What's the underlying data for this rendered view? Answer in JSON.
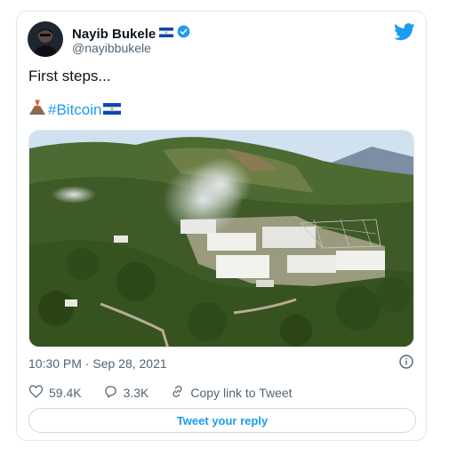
{
  "tweet": {
    "author_name": "Nayib Bukele",
    "author_handle": "@nayibbukele",
    "text": "First steps...",
    "hashtag": "#Bitcoin",
    "timestamp": "10:30 PM · Sep 28, 2021",
    "likes": "59.4K",
    "replies": "3.3K",
    "copy_link_label": "Copy link to Tweet",
    "reply_button_label": "Tweet your reply"
  },
  "icons": [
    "el-salvador-flag-icon",
    "verified-badge-icon",
    "twitter-logo-icon",
    "volcano-emoji-icon",
    "info-icon",
    "heart-icon",
    "reply-icon",
    "link-icon"
  ],
  "colors": {
    "accent": "#1d9bf0",
    "text": "#0f1419",
    "muted": "#536471",
    "border": "#e1e8ed"
  }
}
